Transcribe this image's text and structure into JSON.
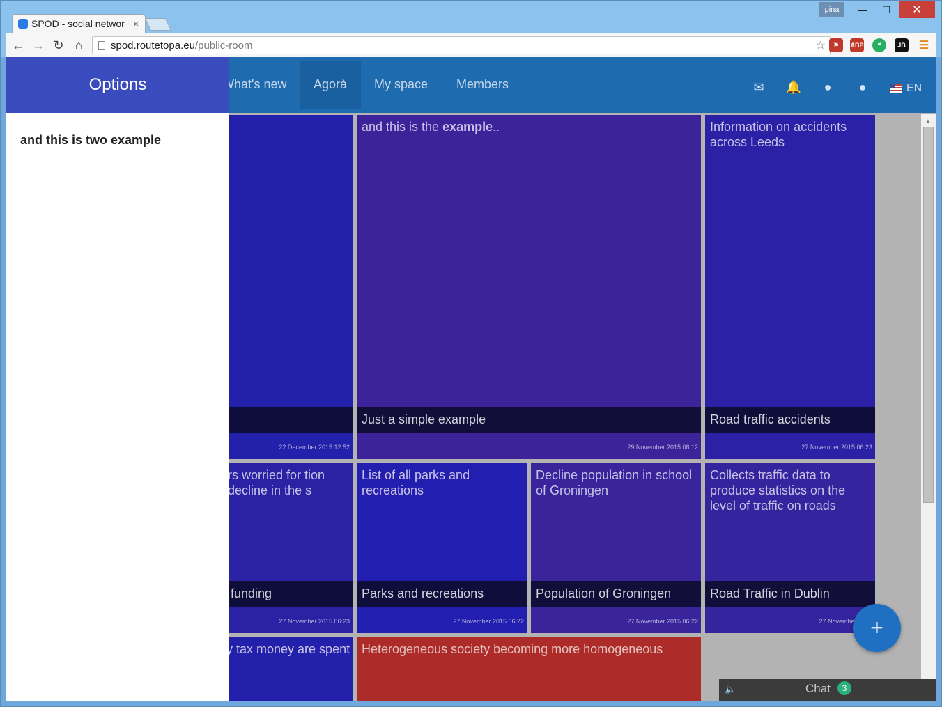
{
  "browser": {
    "tab_title": "SPOD - social networ",
    "tab_close": "×",
    "profile_name": "pina",
    "url_host": "spod.routetopa.eu",
    "url_path": "/public-room",
    "win_min": "—",
    "win_max": "☐",
    "win_close": "✕",
    "ext_abp": "ABP",
    "ext_jb": "JB"
  },
  "topnav": {
    "items": [
      "What's new",
      "Agorà",
      "My space",
      "Members"
    ],
    "active": "Agorà",
    "language": "EN"
  },
  "drawer": {
    "title": "Options",
    "item": "and this is two example"
  },
  "tiles": [
    {
      "name": "",
      "date": "22 December 2015 12:52",
      "color": "#2320ab"
    },
    {
      "desc": "and this is the example..",
      "name": "Just a simple example",
      "date": "29 November 2015 08:12",
      "color": "#3d239a"
    },
    {
      "desc": "Information on accidents across Leeds",
      "name": "Road traffic accidents",
      "date": "27 November 2015 06:23",
      "color": "#2b21a6"
    },
    {
      "desc": "rs worried for tion decline in the s",
      "name": "funding",
      "date": "27 November 2015 06:23",
      "color": "#2a22a5"
    },
    {
      "desc": "List of all parks and recreations",
      "name": "Parks and recreations",
      "date": "27 November 2015 06:22",
      "color": "#211eb0"
    },
    {
      "desc": "Decline population in school of Groningen",
      "name": "Population of Groningen",
      "date": "27 November 2015 06:22",
      "color": "#3a249c"
    },
    {
      "desc": "Collects traffic data to produce statistics on the level of traffic on roads",
      "name": "Road Traffic in Dublin",
      "date": "27 November 2015",
      "color": "#35249e"
    },
    {
      "desc": "y tax money are spent",
      "color": "#2320ab"
    },
    {
      "desc": "Heterogeneous society becoming more homogeneous",
      "color": "#ad2b29"
    }
  ],
  "chat": {
    "label": "Chat",
    "count": "3"
  },
  "fab": {
    "label": "+"
  }
}
